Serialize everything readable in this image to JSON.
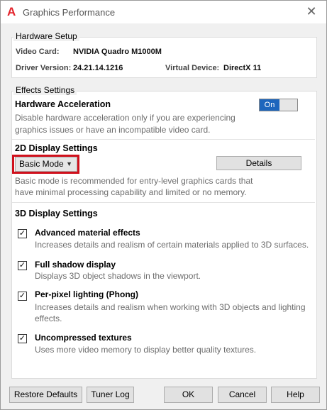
{
  "window": {
    "title": "Graphics Performance",
    "close_label": "✕"
  },
  "hardware": {
    "group_label": "Hardware Setup",
    "video_card_label": "Video Card:",
    "video_card_value": "NVIDIA Quadro M1000M",
    "driver_label": "Driver Version:",
    "driver_value": "24.21.14.1216",
    "virtual_label": "Virtual Device:",
    "virtual_value": "DirectX 11"
  },
  "effects": {
    "group_label": "Effects Settings",
    "hw_accel": {
      "title": "Hardware Acceleration",
      "desc_line1": "Disable hardware acceleration only if you are experiencing",
      "desc_line2": "graphics issues or have an incompatible video card.",
      "toggle_label": "On",
      "toggle_state": "on"
    },
    "display2d": {
      "title": "2D Display Settings",
      "mode_value": "Basic Mode",
      "details_label": "Details",
      "desc_line1": "Basic mode is recommended for entry-level graphics cards that",
      "desc_line2": "have minimal processing capability and limited or no memory."
    },
    "display3d": {
      "title": "3D Display Settings",
      "options": [
        {
          "title": "Advanced material effects",
          "desc_line1": "Increases details and realism of certain materials applied to 3D surfaces.",
          "desc_line2": "",
          "checked": true
        },
        {
          "title": "Full shadow display",
          "desc_line1": "Displays 3D object shadows in the viewport.",
          "desc_line2": "",
          "checked": true
        },
        {
          "title": "Per-pixel lighting (Phong)",
          "desc_line1": "Increases details and realism when working with 3D objects and lighting",
          "desc_line2": "effects.",
          "checked": true
        },
        {
          "title": "Uncompressed textures",
          "desc_line1": "Uses more video memory to display better quality textures.",
          "desc_line2": "",
          "checked": true
        }
      ]
    }
  },
  "buttons": {
    "restore": "Restore Defaults",
    "tuner": "Tuner Log",
    "ok": "OK",
    "cancel": "Cancel",
    "help": "Help"
  },
  "colors": {
    "toggle_on": "#1d66bd",
    "highlight": "#d0101c",
    "app_icon": "#e3222a"
  },
  "icons": {
    "app": "autocad-logo-icon",
    "close": "close-icon",
    "dropdown": "chevron-down-icon",
    "check": "checkmark-icon"
  }
}
